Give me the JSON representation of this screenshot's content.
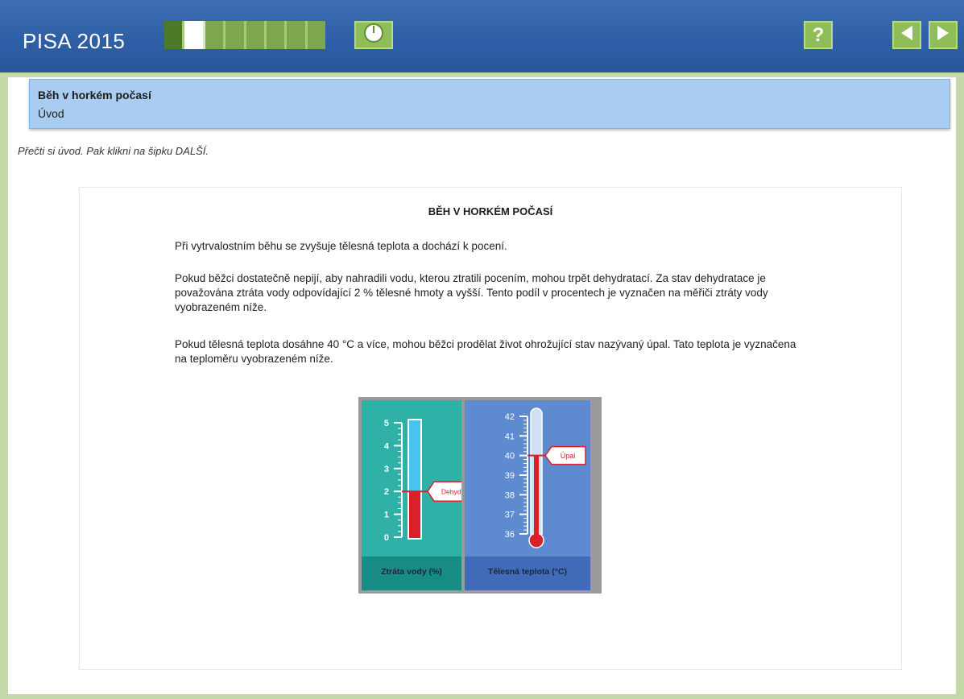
{
  "app": {
    "title": "PISA 2015"
  },
  "progress": {
    "total_segments": 8,
    "completed_segments": 1,
    "current_segment": 2
  },
  "toolbar": {
    "timer_icon": "clock-icon",
    "help_label": "?",
    "help_icon": "help-icon",
    "prev_icon": "arrow-left-icon",
    "next_icon": "arrow-right-icon"
  },
  "unit": {
    "title": "Běh v horkém počasí",
    "subtitle": "Úvod"
  },
  "instruction": "Přečti si úvod. Pak klikni na šipku DALŠÍ.",
  "content": {
    "heading": "BĚH V HORKÉM POČASÍ",
    "paragraphs": [
      "Při vytrvalostním běhu se zvyšuje tělesná teplota a dochází k pocení.",
      "Pokud běžci dostatečně nepijí, aby nahradili vodu, kterou ztratili pocením, mohou trpět dehydratací. Za stav dehydratace je považována ztráta vody odpovídající 2 % tělesné hmoty a vyšší. Tento podíl v procentech je vyznačen na měřiči ztráty vody vyobrazeném níže.",
      "Pokud tělesná teplota dosáhne 40 °C a více, mohou běžci prodělat život ohrožující stav nazývaný úpal. Tato teplota je vyznačena na teploměru vyobrazeném níže."
    ]
  },
  "figure": {
    "water_gauge": {
      "label": "Ztráta vody (%)",
      "ticks": [
        "0",
        "1",
        "2",
        "3",
        "4",
        "5"
      ],
      "min": 0,
      "max": 5,
      "fill_value": 2,
      "marker_value": 2,
      "marker_label": "Dehydratace"
    },
    "thermometer": {
      "label": "Tělesná teplota (°C)",
      "ticks": [
        "36",
        "37",
        "38",
        "39",
        "40",
        "41",
        "42"
      ],
      "min": 36,
      "max": 42,
      "fill_value": 40,
      "marker_value": 40,
      "marker_label": "Úpal"
    },
    "colors": {
      "water_panel": "#2fb1a8",
      "temp_panel": "#5e8ad0",
      "fill_red": "#d8212b",
      "tube_blue": "#48c4f0"
    }
  }
}
